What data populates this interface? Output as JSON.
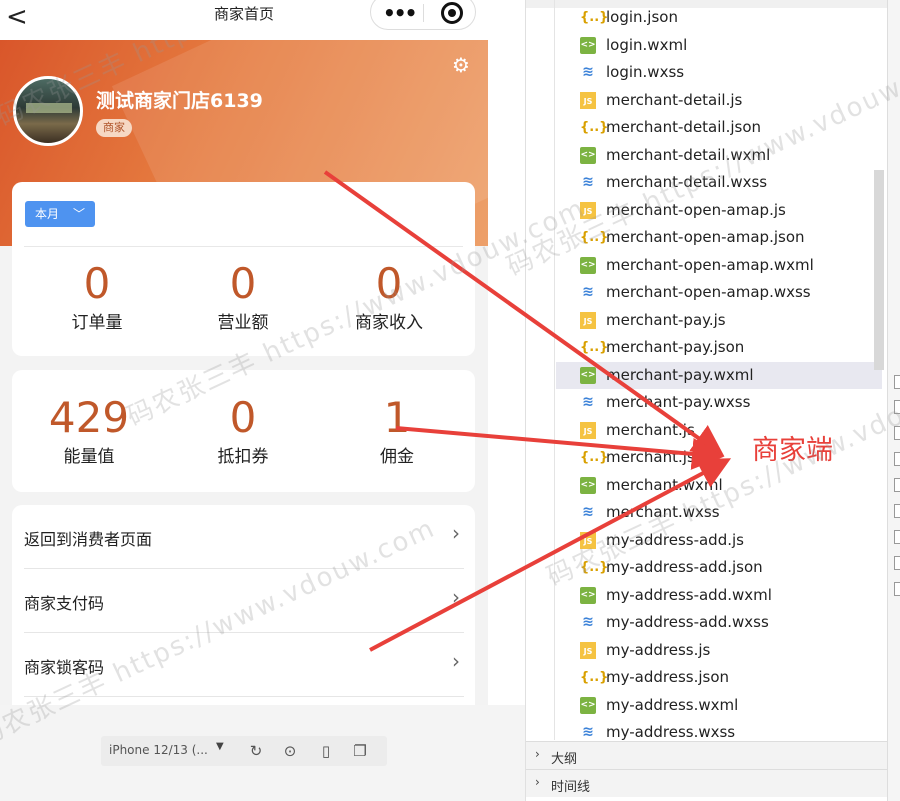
{
  "simulator": {
    "nav_title": "商家首页",
    "back_glyph": "<",
    "shop_name": "测试商家门店6139",
    "shop_tag": "商家",
    "period_label": "本月",
    "stats_top": [
      {
        "value": "0",
        "label": "订单量"
      },
      {
        "value": "0",
        "label": "营业额"
      },
      {
        "value": "0",
        "label": "商家收入"
      }
    ],
    "stats_bottom": [
      {
        "value": "429",
        "label": "能量值"
      },
      {
        "value": "0",
        "label": "抵扣券"
      },
      {
        "value": "1",
        "label": "佣金"
      }
    ],
    "menu": [
      {
        "label": "返回到消费者页面"
      },
      {
        "label": "商家支付码"
      },
      {
        "label": "商家锁客码"
      }
    ],
    "device": "iPhone 12/13 (...",
    "accent": "#c0582a",
    "hero_color": "#e06a33"
  },
  "file_tree": {
    "files": [
      {
        "name": "login.json",
        "type": "json"
      },
      {
        "name": "login.wxml",
        "type": "wxml"
      },
      {
        "name": "login.wxss",
        "type": "wxss"
      },
      {
        "name": "merchant-detail.js",
        "type": "js"
      },
      {
        "name": "merchant-detail.json",
        "type": "json"
      },
      {
        "name": "merchant-detail.wxml",
        "type": "wxml"
      },
      {
        "name": "merchant-detail.wxss",
        "type": "wxss"
      },
      {
        "name": "merchant-open-amap.js",
        "type": "js"
      },
      {
        "name": "merchant-open-amap.json",
        "type": "json"
      },
      {
        "name": "merchant-open-amap.wxml",
        "type": "wxml"
      },
      {
        "name": "merchant-open-amap.wxss",
        "type": "wxss"
      },
      {
        "name": "merchant-pay.js",
        "type": "js"
      },
      {
        "name": "merchant-pay.json",
        "type": "json"
      },
      {
        "name": "merchant-pay.wxml",
        "type": "wxml",
        "selected": true
      },
      {
        "name": "merchant-pay.wxss",
        "type": "wxss"
      },
      {
        "name": "merchant.js",
        "type": "js"
      },
      {
        "name": "merchant.json",
        "type": "json"
      },
      {
        "name": "merchant.wxml",
        "type": "wxml"
      },
      {
        "name": "merchant.wxss",
        "type": "wxss"
      },
      {
        "name": "my-address-add.js",
        "type": "js"
      },
      {
        "name": "my-address-add.json",
        "type": "json"
      },
      {
        "name": "my-address-add.wxml",
        "type": "wxml"
      },
      {
        "name": "my-address-add.wxss",
        "type": "wxss"
      },
      {
        "name": "my-address.js",
        "type": "js"
      },
      {
        "name": "my-address.json",
        "type": "json"
      },
      {
        "name": "my-address.wxml",
        "type": "wxml"
      },
      {
        "name": "my-address.wxss",
        "type": "wxss"
      }
    ],
    "sections": [
      {
        "label": "大纲"
      },
      {
        "label": "时间线"
      }
    ]
  },
  "annotation": {
    "callout": "商家端",
    "color": "#e8403a"
  },
  "watermark": {
    "text": "码农张三丰 https://www.vdouw.com"
  },
  "icons": {
    "back": "chevron-left-icon",
    "more": "more-dots-icon",
    "target": "record-target-icon",
    "settings": "gear-icon",
    "menu_arrow": "chevron-right-icon",
    "refresh": "refresh-icon",
    "stop": "stop-icon",
    "phone": "phone-icon",
    "window": "window-icon"
  }
}
